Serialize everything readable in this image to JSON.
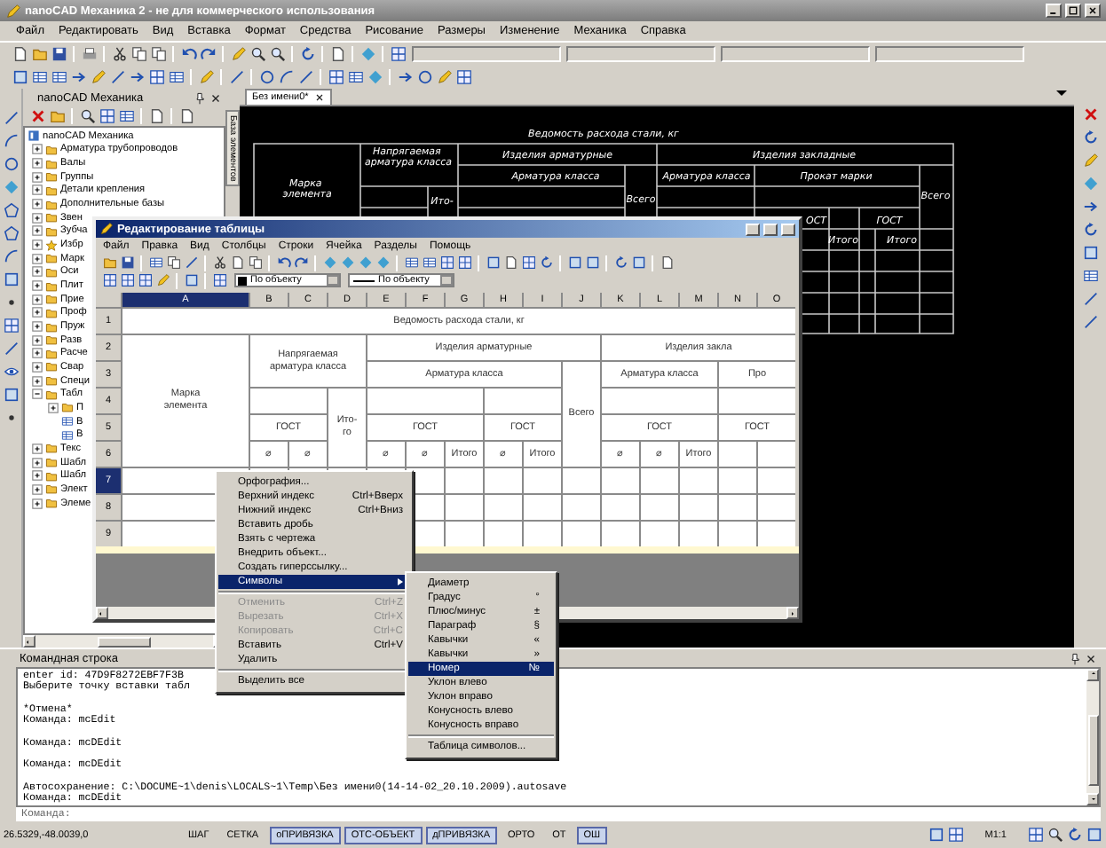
{
  "window": {
    "title": "nanoCAD Механика 2 - не для коммерческого использования"
  },
  "menu": [
    "Файл",
    "Редактировать",
    "Вид",
    "Вставка",
    "Формат",
    "Средства",
    "Рисование",
    "Размеры",
    "Изменение",
    "Механика",
    "Справка"
  ],
  "left_panel": {
    "title": "nanoCAD Механика",
    "side_tab": "База элементов",
    "tree": [
      {
        "label": "nanoCAD Механика",
        "kind": "root",
        "children": [
          {
            "label": "Арматура трубопроводов",
            "kind": "folder",
            "expanded": false
          },
          {
            "label": "Валы",
            "kind": "folder",
            "expanded": false
          },
          {
            "label": "Группы",
            "kind": "folder",
            "expanded": false
          },
          {
            "label": "Детали крепления",
            "kind": "folder",
            "expanded": false
          },
          {
            "label": "Дополнительные базы",
            "kind": "folder",
            "expanded": false
          },
          {
            "label": "Звен",
            "kind": "folder",
            "expanded": false
          },
          {
            "label": "Зубча",
            "kind": "folder",
            "expanded": false
          },
          {
            "label": "Избр",
            "kind": "favorites",
            "expanded": false
          },
          {
            "label": "Марк",
            "kind": "folder",
            "expanded": false
          },
          {
            "label": "Оси",
            "kind": "folder",
            "expanded": false
          },
          {
            "label": "Плит",
            "kind": "folder",
            "expanded": false
          },
          {
            "label": "Прие",
            "kind": "folder",
            "expanded": false
          },
          {
            "label": "Проф",
            "kind": "folder",
            "expanded": false
          },
          {
            "label": "Пруж",
            "kind": "folder",
            "expanded": false
          },
          {
            "label": "Разв",
            "kind": "folder",
            "expanded": false
          },
          {
            "label": "Расче",
            "kind": "folder",
            "expanded": false
          },
          {
            "label": "Свар",
            "kind": "folder",
            "expanded": false
          },
          {
            "label": "Специ",
            "kind": "folder",
            "expanded": false
          },
          {
            "label": "Табл",
            "kind": "folder",
            "expanded": true,
            "children": [
              {
                "label": "П",
                "kind": "folder",
                "expanded": false
              },
              {
                "label": "В",
                "kind": "table"
              },
              {
                "label": "В",
                "kind": "table"
              }
            ]
          },
          {
            "label": "Текс",
            "kind": "folder",
            "expanded": false
          },
          {
            "label": "Шабл",
            "kind": "folder",
            "expanded": false
          },
          {
            "label": "Шабл",
            "kind": "folder",
            "expanded": false
          },
          {
            "label": "Элект",
            "kind": "folder",
            "expanded": false
          },
          {
            "label": "Элеме",
            "kind": "folder",
            "expanded": false
          }
        ]
      }
    ]
  },
  "document_tabs": [
    {
      "label": "Без имени0*",
      "selected": true
    }
  ],
  "drawing": {
    "title": "Ведомость расхода стали, кг",
    "prestressed": "Напрягаемая арматура класса",
    "rebar_products": "Изделия арматурные",
    "embedded_products": "Изделия закладные",
    "rebar_class_1": "Арматура класса",
    "rebar_class_2": "Арматура класса",
    "rolled_grade": "Прокат марки",
    "mark": "Марка элемента",
    "subtotal": "Ито-",
    "total_1": "Всего",
    "total_2": "Всего",
    "gost_1": "ОСТ",
    "gost_2": "ГОСТ",
    "sum_1": "Итого",
    "sum_2": "Итого"
  },
  "table_editor": {
    "title": "Редактирование таблицы",
    "menu": [
      "Файл",
      "Правка",
      "Вид",
      "Столбцы",
      "Строки",
      "Ячейка",
      "Разделы",
      "Помощь"
    ],
    "line_color": "По объекту",
    "line_type": "По объекту",
    "columns": [
      {
        "label": "A",
        "selected": true
      },
      {
        "label": "B",
        "selected": false
      },
      {
        "label": "C",
        "selected": false
      },
      {
        "label": "D",
        "selected": false
      },
      {
        "label": "E",
        "selected": false
      },
      {
        "label": "F",
        "selected": false
      },
      {
        "label": "G",
        "selected": false
      },
      {
        "label": "H",
        "selected": false
      },
      {
        "label": "I",
        "selected": false
      },
      {
        "label": "J",
        "selected": false
      },
      {
        "label": "K",
        "selected": false
      },
      {
        "label": "L",
        "selected": false
      },
      {
        "label": "M",
        "selected": false
      },
      {
        "label": "N",
        "selected": false
      },
      {
        "label": "O",
        "selected": false
      }
    ],
    "rows": [
      {
        "label": "1",
        "selected": false
      },
      {
        "label": "2",
        "selected": false
      },
      {
        "label": "3",
        "selected": false
      },
      {
        "label": "4",
        "selected": false
      },
      {
        "label": "5",
        "selected": false
      },
      {
        "label": "6",
        "selected": false
      },
      {
        "label": "7",
        "selected": true
      },
      {
        "label": "8",
        "selected": false
      },
      {
        "label": "9",
        "selected": false
      }
    ],
    "cells": [
      "Ведомость расхода стали, кг",
      "Марка\nэлемента",
      "Напрягаемая\nарматура класса",
      "Изделия арматурные",
      "Изделия закла",
      "Арматура класса",
      "Арматура класса",
      "Про",
      "ГОСТ",
      "Ито-\nго",
      "ГОСТ",
      "ГОСТ",
      "Всего",
      "ГОСТ",
      "ГОСТ",
      "⌀",
      "⌀",
      "⌀",
      "⌀",
      "Итого",
      "⌀",
      "Итого",
      "⌀",
      "⌀",
      "Итого"
    ]
  },
  "context_menu": {
    "items": [
      {
        "kind": "item",
        "label": "Орфография...",
        "disabled": false,
        "selected": false,
        "has_submenu": false
      },
      {
        "kind": "item",
        "label": "Верхний индекс",
        "shortcut": "Ctrl+Вверх",
        "disabled": false,
        "selected": false,
        "has_submenu": false
      },
      {
        "kind": "item",
        "label": "Нижний индекс",
        "shortcut": "Ctrl+Вниз",
        "disabled": false,
        "selected": false,
        "has_submenu": false
      },
      {
        "kind": "item",
        "label": "Вставить дробь",
        "disabled": false,
        "selected": false,
        "has_submenu": false
      },
      {
        "kind": "item",
        "label": "Взять с чертежа",
        "disabled": false,
        "selected": false,
        "has_submenu": false
      },
      {
        "kind": "item",
        "label": "Внедрить объект...",
        "disabled": false,
        "selected": false,
        "has_submenu": false
      },
      {
        "kind": "item",
        "label": "Создать гиперссылку...",
        "disabled": false,
        "selected": false,
        "has_submenu": false
      },
      {
        "kind": "item",
        "label": "Символы",
        "disabled": false,
        "selected": true,
        "has_submenu": true
      },
      {
        "kind": "separator"
      },
      {
        "kind": "item",
        "label": "Отменить",
        "shortcut": "Ctrl+Z",
        "disabled": true,
        "selected": false,
        "has_submenu": false
      },
      {
        "kind": "item",
        "label": "Вырезать",
        "shortcut": "Ctrl+X",
        "disabled": true,
        "selected": false,
        "has_submenu": false
      },
      {
        "kind": "item",
        "label": "Копировать",
        "shortcut": "Ctrl+C",
        "disabled": true,
        "selected": false,
        "has_submenu": false
      },
      {
        "kind": "item",
        "label": "Вставить",
        "shortcut": "Ctrl+V",
        "disabled": false,
        "selected": false,
        "has_submenu": false
      },
      {
        "kind": "item",
        "label": "Удалить",
        "disabled": false,
        "selected": false,
        "has_submenu": false
      },
      {
        "kind": "separator"
      },
      {
        "kind": "item",
        "label": "Выделить все",
        "disabled": false,
        "selected": false,
        "has_submenu": false
      }
    ]
  },
  "submenu": {
    "items": [
      {
        "kind": "item",
        "label": "Диаметр",
        "selected": false
      },
      {
        "kind": "item",
        "label": "Градус",
        "symbol": "°",
        "selected": false
      },
      {
        "kind": "item",
        "label": "Плюс/минус",
        "symbol": "±",
        "selected": false
      },
      {
        "kind": "item",
        "label": "Параграф",
        "symbol": "§",
        "selected": false
      },
      {
        "kind": "item",
        "label": "Кавычки",
        "symbol": "«",
        "selected": false
      },
      {
        "kind": "item",
        "label": "Кавычки",
        "symbol": "»",
        "selected": false
      },
      {
        "kind": "item",
        "label": "Номер",
        "symbol": "№",
        "selected": true
      },
      {
        "kind": "item",
        "label": "Уклон влево",
        "selected": false
      },
      {
        "kind": "item",
        "label": "Уклон вправо",
        "selected": false
      },
      {
        "kind": "item",
        "label": "Конусность влево",
        "selected": false
      },
      {
        "kind": "item",
        "label": "Конусность вправо",
        "selected": false
      },
      {
        "kind": "separator"
      },
      {
        "kind": "item",
        "label": "Таблица символов...",
        "selected": false
      }
    ]
  },
  "command_line": {
    "title": "Командная строка",
    "blocks": [
      [
        "enter id: 47D9F8272EBF7F3B",
        "Выберите точку вставки табл"
      ],
      [
        "*Отмена*",
        "Команда: mcEdit"
      ],
      [
        "Команда: mcDEdit"
      ],
      [
        "Команда: mcDEdit"
      ],
      [
        "Автосохранение: C:\\DOCUME~1\\denis\\LOCALS~1\\Temp\\Без имени0(14-14-02_20.10.2009).autosave",
        "Команда: mcDEdit"
      ]
    ],
    "prompt": "Команда:"
  },
  "status_bar": {
    "coordinates": "26.5329,-48.0039,0",
    "toggles": [
      {
        "label": "ШАГ",
        "on": false
      },
      {
        "label": "СЕТКА",
        "on": false
      },
      {
        "label": "оПРИВЯЗКА",
        "on": true
      },
      {
        "label": "ОТС-ОБЪЕКТ",
        "on": true
      },
      {
        "label": "дПРИВЯЗКА",
        "on": true
      },
      {
        "label": "ОРТО",
        "on": false
      },
      {
        "label": "ОТ",
        "on": false
      },
      {
        "label": "ОШ",
        "on": true
      }
    ],
    "scale": "М1:1"
  }
}
